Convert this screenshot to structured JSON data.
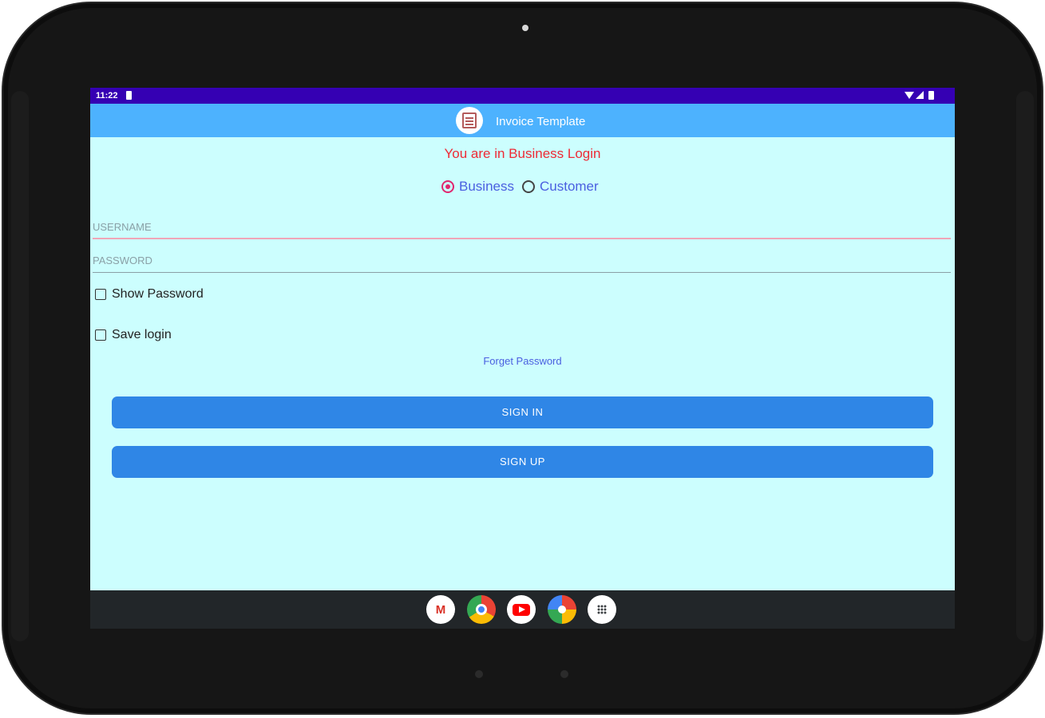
{
  "status_bar": {
    "time": "11:22"
  },
  "app_bar": {
    "title": "Invoice Template"
  },
  "login": {
    "notice": "You are in Business Login",
    "radio_business": "Business",
    "radio_customer": "Customer",
    "selected_mode": "Business",
    "username_placeholder": "USERNAME",
    "password_placeholder": "PASSWORD",
    "show_password_label": "Show Password",
    "save_login_label": "Save login",
    "forgot_password": "Forget Password",
    "sign_in": "SIGN IN",
    "sign_up": "SIGN UP"
  },
  "dock": {
    "gmail_glyph": "M",
    "icons": [
      "gmail-icon",
      "chrome-icon",
      "youtube-icon",
      "photos-icon",
      "app-drawer-icon"
    ]
  },
  "colors": {
    "status_bar": "#3500b3",
    "app_bar": "#4db2fe",
    "background": "#ccfefe",
    "notice": "#ee2a35",
    "accent_radio": "#e0256e",
    "button": "#2f86e6",
    "link": "#4a5fe0"
  }
}
